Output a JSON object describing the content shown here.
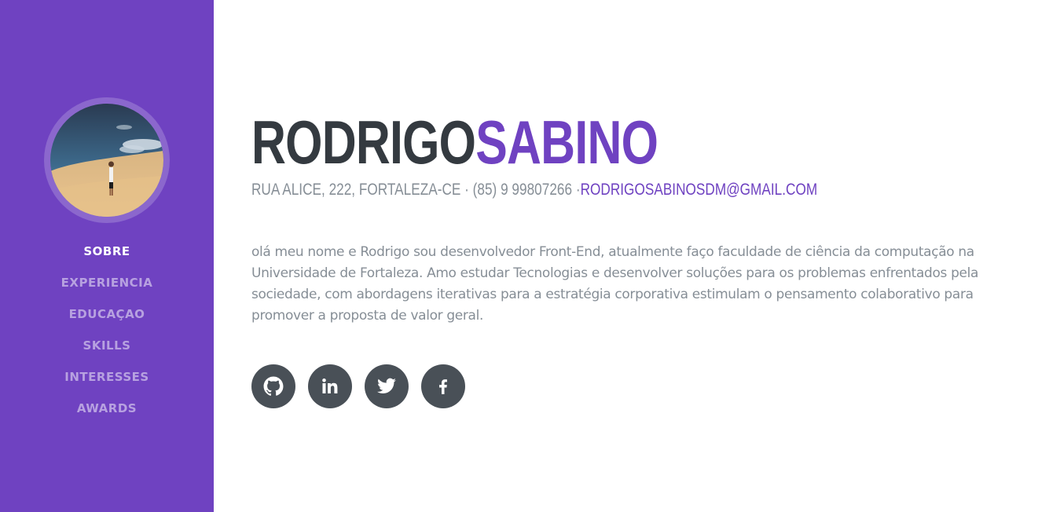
{
  "profile": {
    "first_name": "RODRIGO",
    "last_name": "SABINO",
    "address": "RUA ALICE, 222, FORTALEZA-CE · (85) 9 99807266 ·",
    "email": "RODRIGOSABINOSDM@GMAIL.COM",
    "bio": "olá meu nome e Rodrigo sou desenvolvedor Front-End, atualmente faço faculdade de ciência da computação na Universidade de Fortaleza. Amo estudar Tecnologias e desenvolver soluções para os problemas enfrentados pela sociedade, com abordagens iterativas para a estratégia corporativa estimulam o pensamento colaborativo para promover a proposta de valor geral."
  },
  "nav": {
    "items": [
      {
        "label": "SOBRE",
        "active": true
      },
      {
        "label": "EXPERIENCIA",
        "active": false
      },
      {
        "label": "EDUCAÇAO",
        "active": false
      },
      {
        "label": "SKILLS",
        "active": false
      },
      {
        "label": "INTERESSES",
        "active": false
      },
      {
        "label": "AWARDS",
        "active": false
      }
    ]
  },
  "social": [
    {
      "icon": "github-icon"
    },
    {
      "icon": "linkedin-icon"
    },
    {
      "icon": "twitter-icon"
    },
    {
      "icon": "facebook-icon"
    }
  ],
  "colors": {
    "primary": "#6f42c1",
    "dark": "#343a40",
    "muted": "#868e96",
    "social_bg": "#495057"
  }
}
